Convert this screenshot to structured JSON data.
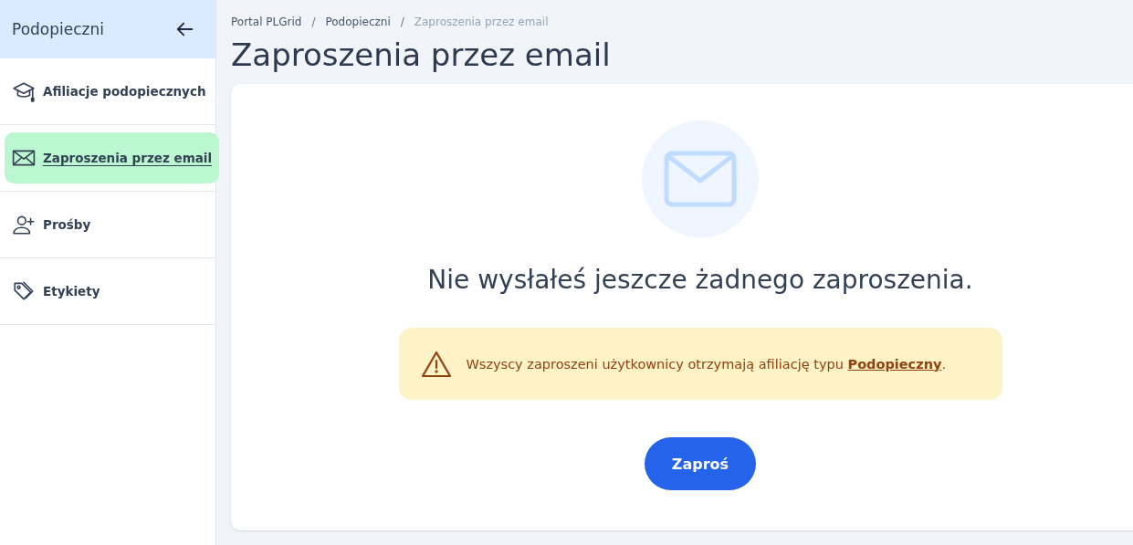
{
  "sidebar": {
    "title": "Podopieczni",
    "items": [
      {
        "kind": "graduation",
        "label": "Afiliacje podopiecznych",
        "selected": false
      },
      {
        "kind": "mail",
        "label": "Zaproszenia przez email",
        "selected": true
      },
      {
        "kind": "user-plus",
        "label": "Prośby",
        "selected": false
      },
      {
        "kind": "tags",
        "label": "Etykiety",
        "selected": false
      }
    ]
  },
  "breadcrumbs": [
    "Portal PLGrid",
    "Podopieczni",
    "Zaproszenia przez email"
  ],
  "breadcrumb_separators": [
    "/",
    "/"
  ],
  "title": "Zaproszenia przez email",
  "empty_state": {
    "message": "Nie wysłałeś jeszcze żadnego zaproszenia.",
    "alert": {
      "text_before": "Wszyscy zaproszeni użytkownicy otrzymają afiliację typu ",
      "link": "Podopieczny",
      "text_after": "."
    },
    "button": "Zaproś"
  }
}
